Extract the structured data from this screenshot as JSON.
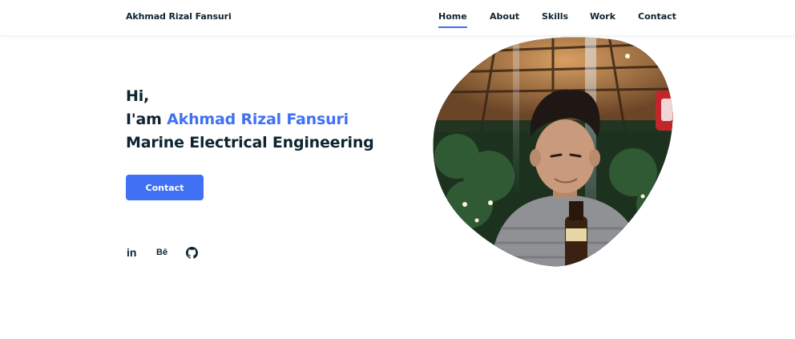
{
  "header": {
    "logo": "Akhmad Rizal Fansuri",
    "nav": [
      {
        "label": "Home",
        "active": true
      },
      {
        "label": "About",
        "active": false
      },
      {
        "label": "Skills",
        "active": false
      },
      {
        "label": "Work",
        "active": false
      },
      {
        "label": "Contact",
        "active": false
      }
    ]
  },
  "hero": {
    "greeting": "Hi,",
    "intro_prefix": "I'am",
    "name": "Akhmad Rizal Fansuri",
    "subtitle": "Marine Electrical Engineering",
    "button_label": "Contact"
  },
  "social": [
    {
      "icon": "linkedin-icon",
      "text": "in"
    },
    {
      "icon": "behance-icon",
      "text": "Bē"
    },
    {
      "icon": "github-icon",
      "text": ""
    }
  ],
  "colors": {
    "accent": "#4070f4",
    "text": "#0e2431",
    "background": "#ffffff"
  }
}
